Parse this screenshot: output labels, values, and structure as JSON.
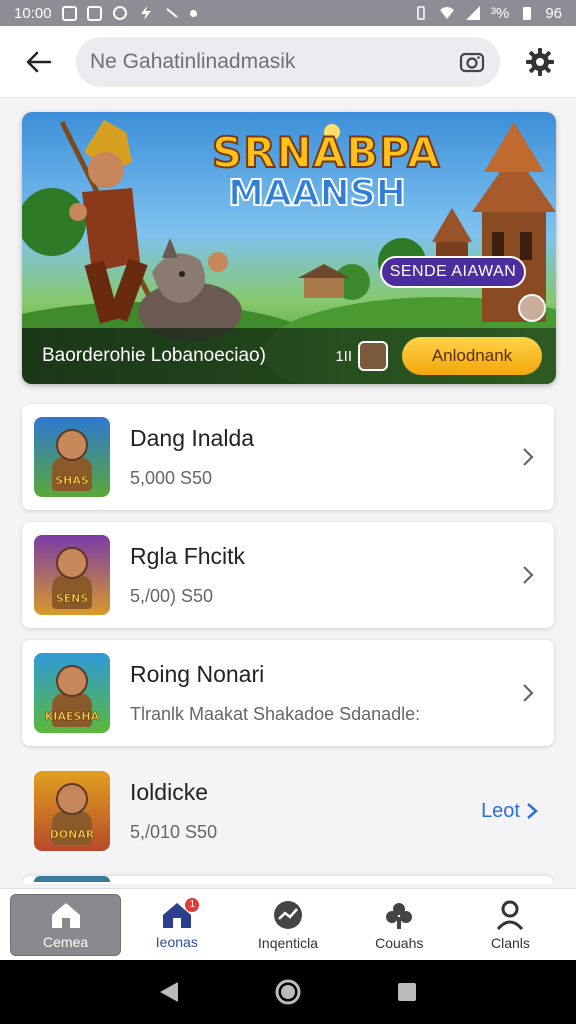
{
  "status_bar": {
    "time": "10:00",
    "battery": "96",
    "signal_label": "³%"
  },
  "top_bar": {
    "search_placeholder": "Ne Gahatinlinadmasik"
  },
  "banner": {
    "title_line1": "SRNABPA",
    "title_line2": "MAANSH",
    "tag": "SENDE AIAWAN",
    "caption": "Baorderohie Lobanoeciao)",
    "meta": "1II",
    "button": "Anlodnank"
  },
  "list": {
    "items": [
      {
        "title": "Dang Inalda",
        "subtitle": "5,000 S50",
        "thumb_label": "SHAS",
        "thumb_colors": [
          "#2f78d0",
          "#5aa83a"
        ],
        "action": "chevron"
      },
      {
        "title": "Rgla Fhcitk",
        "subtitle": "5,/00) S50",
        "thumb_label": "SENS",
        "thumb_colors": [
          "#7a3aa8",
          "#d89a2a"
        ],
        "action": "chevron"
      },
      {
        "title": "Roing Nonari",
        "subtitle": "Tlranlk Maakat Shakadoe Sdanadle:",
        "thumb_label": "KIAESHA",
        "thumb_colors": [
          "#2f9ad8",
          "#5ab83a"
        ],
        "action": "chevron"
      },
      {
        "title": "Ioldicke",
        "subtitle": "5,/010 S50",
        "thumb_label": "DONAR",
        "thumb_colors": [
          "#e0a020",
          "#b84a2a"
        ],
        "action": "link",
        "link_label": "Leot"
      }
    ]
  },
  "bottom_nav": {
    "items": [
      {
        "label": "Cemea",
        "icon": "home-icon",
        "active": true
      },
      {
        "label": "Ieonas",
        "icon": "house-badge-icon",
        "badge": "1"
      },
      {
        "label": "Inqenticla",
        "icon": "trend-icon"
      },
      {
        "label": "Couahs",
        "icon": "club-icon"
      },
      {
        "label": "Clanls",
        "icon": "profile-icon"
      }
    ]
  },
  "colors": {
    "accent": "#2a6fd6",
    "banner_tag": "#4b2d9e",
    "banner_button": "#f4a60c",
    "badge": "#e53935"
  }
}
